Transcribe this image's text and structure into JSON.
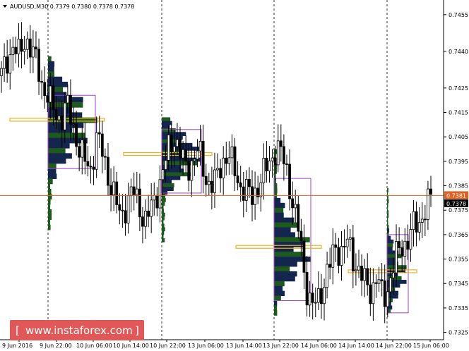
{
  "window": {
    "symbol_line": "AUDUSD,M30  0.7379 0.7380 0.7378 0.7378",
    "menu_arrow": "triangle-down-icon"
  },
  "watermark": {
    "text": "www.instaforex.com",
    "icon": "instaforex-logo-icon"
  },
  "colors": {
    "bull": "#000000",
    "bear": "#000000",
    "current_line": "#e06020",
    "current_bg": "#e06020",
    "price_bg": "#000000",
    "vp_dark": "#14264e",
    "vp_green": "#1e5a1e",
    "vp_box": "#a040d0",
    "poc": "#f0b020",
    "watermark_bg": "#e05858"
  },
  "chart_data": {
    "type": "candlestick",
    "ylim": [
      0.7322,
      0.7461
    ],
    "y_ticks": [
      "0.7455",
      "0.7440",
      "0.7425",
      "0.7415",
      "0.7405",
      "0.7395",
      "0.7385",
      "0.7375",
      "0.7365",
      "0.7355",
      "0.7345",
      "0.7335",
      "0.7325"
    ],
    "x_labels": [
      "9 Jun 2016",
      "9 Jun 22:00",
      "10 Jun 06:00",
      "10 Jun 14:00",
      "10 Jun 22:00",
      "13 Jun 06:00",
      "13 Jun 14:00",
      "13 Jun 22:00",
      "14 Jun 06:00",
      "14 Jun 14:00",
      "14 Jun 22:00",
      "15 Jun 06:00"
    ],
    "session_separators": [
      "9 Jun 22:00",
      "10 Jun 22:00",
      "13 Jun 22:00",
      "14 Jun 22:00"
    ],
    "current_price": "0.7381",
    "last_price": "0.7378",
    "close_path": [
      0.743,
      0.7437,
      0.7442,
      0.7438,
      0.7446,
      0.744,
      0.7435,
      0.7425,
      0.742,
      0.7415,
      0.7412,
      0.7418,
      0.741,
      0.74,
      0.7395,
      0.7392,
      0.7405,
      0.7398,
      0.7388,
      0.738,
      0.7372,
      0.7378,
      0.7383,
      0.7378,
      0.737,
      0.7375,
      0.7382,
      0.739,
      0.74,
      0.7405,
      0.7398,
      0.7392,
      0.7395,
      0.74,
      0.739,
      0.7385,
      0.7387,
      0.7395,
      0.7398,
      0.7392,
      0.7385,
      0.7383,
      0.738,
      0.7385,
      0.739,
      0.7395,
      0.74,
      0.7398,
      0.739,
      0.7375,
      0.7365,
      0.7345,
      0.7335,
      0.7338,
      0.7345,
      0.7352,
      0.736,
      0.7358,
      0.7362,
      0.7355,
      0.735,
      0.7345,
      0.7342,
      0.7348,
      0.7338,
      0.7345,
      0.7355,
      0.736,
      0.7362,
      0.7368,
      0.737,
      0.7375,
      0.738
    ],
    "volume_profiles": [
      {
        "session": "9 Jun 22:00",
        "poc": 0.7412
      },
      {
        "session": "10 Jun 22:00",
        "poc": 0.7398
      },
      {
        "session": "13 Jun 22:00",
        "poc": 0.736
      },
      {
        "session": "14 Jun 22:00",
        "poc": 0.735
      }
    ]
  }
}
